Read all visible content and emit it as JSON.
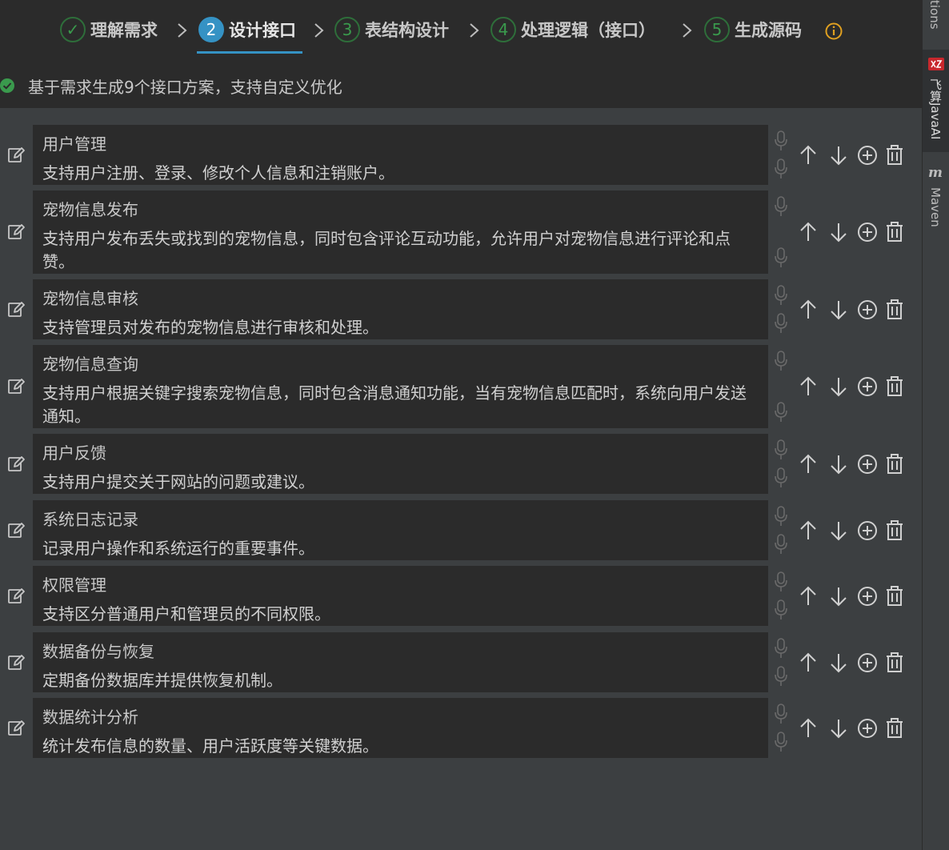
{
  "stepper": {
    "steps": [
      {
        "num": "✓",
        "label": "理解需求",
        "state": "done"
      },
      {
        "num": "2",
        "label": "设计接口",
        "state": "active"
      },
      {
        "num": "3",
        "label": "表结构设计",
        "state": "pending"
      },
      {
        "num": "4",
        "label": "处理逻辑（接口）",
        "state": "pending"
      },
      {
        "num": "5",
        "label": "生成源码",
        "state": "pending"
      }
    ]
  },
  "status": {
    "text": "基于需求生成9个接口方案，支持自定义优化"
  },
  "interfaces": [
    {
      "title": "用户管理",
      "desc": "支持用户注册、登录、修改个人信息和注销账户。"
    },
    {
      "title": "宠物信息发布",
      "desc": "支持用户发布丢失或找到的宠物信息，同时包含评论互动功能，允许用户对宠物信息进行评论和点赞。"
    },
    {
      "title": "宠物信息审核",
      "desc": "支持管理员对发布的宠物信息进行审核和处理。"
    },
    {
      "title": "宠物信息查询",
      "desc": "支持用户根据关键字搜索宠物信息，同时包含消息通知功能，当有宠物信息匹配时，系统向用户发送通知。"
    },
    {
      "title": "用户反馈",
      "desc": "支持用户提交关于网站的问题或建议。"
    },
    {
      "title": "系统日志记录",
      "desc": "记录用户操作和系统运行的重要事件。"
    },
    {
      "title": "权限管理",
      "desc": "支持区分普通用户和管理员的不同权限。"
    },
    {
      "title": "数据备份与恢复",
      "desc": "定期备份数据库并提供恢复机制。"
    },
    {
      "title": "数据统计分析",
      "desc": "统计发布信息的数量、用户活跃度等关键数据。"
    }
  ],
  "toolwindows": {
    "top_partial": "tions",
    "feisuan": "飞算JavaAI",
    "maven": "Maven"
  },
  "colors": {
    "accent": "#3592c4",
    "done_green": "#3a9a4d",
    "warning": "#e0a020",
    "card_bg": "#2b2b2b",
    "panel_bg": "#3c3f41"
  },
  "icons": {
    "edit": "edit-icon",
    "mic": "microphone-icon",
    "up": "arrow-up-icon",
    "down": "arrow-down-icon",
    "add": "add-circle-icon",
    "delete": "trash-icon",
    "info": "info-icon",
    "check": "check-circle-icon"
  }
}
